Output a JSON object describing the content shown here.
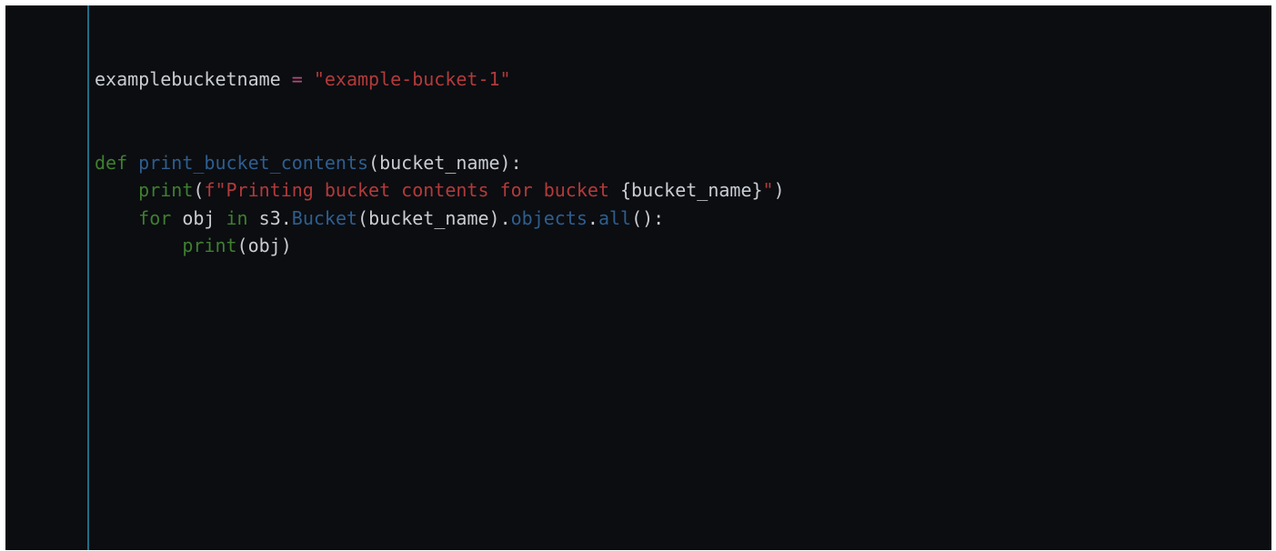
{
  "editor": {
    "lines": [
      {
        "id": "line-1",
        "tokens": [
          {
            "type": "ident",
            "text": "examplebucketname"
          },
          {
            "type": "punct",
            "text": " "
          },
          {
            "type": "op",
            "text": "="
          },
          {
            "type": "punct",
            "text": " "
          },
          {
            "type": "str",
            "text": "\"example-bucket-1\""
          }
        ]
      },
      {
        "id": "line-2",
        "tokens": []
      },
      {
        "id": "line-3",
        "tokens": []
      },
      {
        "id": "line-4",
        "tokens": [
          {
            "type": "kw",
            "text": "def"
          },
          {
            "type": "punct",
            "text": " "
          },
          {
            "type": "fn",
            "text": "print_bucket_contents"
          },
          {
            "type": "punct",
            "text": "(bucket_name):"
          }
        ]
      },
      {
        "id": "line-5",
        "tokens": [
          {
            "type": "punct",
            "text": "    "
          },
          {
            "type": "builtin",
            "text": "print"
          },
          {
            "type": "punct",
            "text": "("
          },
          {
            "type": "str",
            "text": "f\"Printing bucket contents for bucket "
          },
          {
            "type": "ident",
            "text": "{bucket_name}"
          },
          {
            "type": "str",
            "text": "\""
          },
          {
            "type": "punct",
            "text": ")"
          }
        ]
      },
      {
        "id": "line-6",
        "tokens": [
          {
            "type": "punct",
            "text": "    "
          },
          {
            "type": "kw",
            "text": "for"
          },
          {
            "type": "ident",
            "text": " obj "
          },
          {
            "type": "kw",
            "text": "in"
          },
          {
            "type": "ident",
            "text": " s3."
          },
          {
            "type": "attr",
            "text": "Bucket"
          },
          {
            "type": "punct",
            "text": "(bucket_name)."
          },
          {
            "type": "attr",
            "text": "objects"
          },
          {
            "type": "punct",
            "text": "."
          },
          {
            "type": "attr",
            "text": "all"
          },
          {
            "type": "punct",
            "text": "():"
          }
        ]
      },
      {
        "id": "line-7",
        "tokens": [
          {
            "type": "punct",
            "text": "        "
          },
          {
            "type": "builtin",
            "text": "print"
          },
          {
            "type": "punct",
            "text": "(obj)"
          }
        ]
      }
    ]
  }
}
